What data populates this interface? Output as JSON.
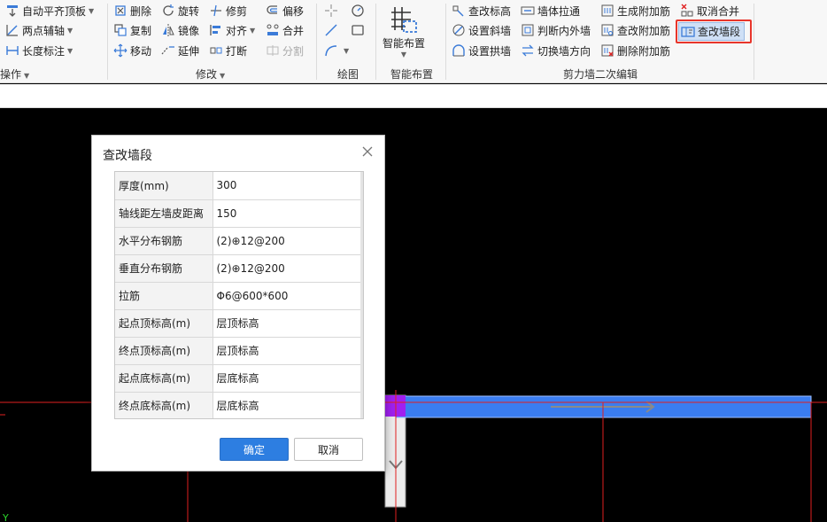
{
  "ribbon": {
    "col1": [
      {
        "label": "自动平齐顶板",
        "icon": "auto-align-top-icon",
        "caret": true
      },
      {
        "label": "两点辅轴",
        "icon": "two-point-axis-icon",
        "caret": true
      },
      {
        "label": "长度标注",
        "icon": "length-dimension-icon",
        "caret": true
      }
    ],
    "group_ops_label": "操作",
    "modify": {
      "delete": "删除",
      "rotate": "旋转",
      "trim": "修剪",
      "offset": "偏移",
      "copy": "复制",
      "mirror": "镜像",
      "align": "对齐",
      "merge": "合并",
      "move": "移动",
      "extend": "延伸",
      "break": "打断",
      "split": "分割",
      "group_label": "修改"
    },
    "draw": {
      "group_label": "绘图"
    },
    "smart": {
      "label": "智能布置",
      "group_label": "智能布置"
    },
    "shearwall": {
      "group_label": "剪力墙二次编辑",
      "check_elev": "查改标高",
      "wall_pull": "墙体拉通",
      "gen_rebar": "生成附加筋",
      "cancel_merge": "取消合并",
      "set_slope": "设置斜墙",
      "judge_inout": "判断内外墙",
      "edit_rebar": "查改附加筋",
      "edit_segment": "查改墙段",
      "set_arch": "设置拱墙",
      "switch_dir": "切换墙方向",
      "del_rebar": "删除附加筋"
    }
  },
  "dialog": {
    "title": "查改墙段",
    "rows": [
      {
        "key": "厚度(mm)",
        "value": "300"
      },
      {
        "key": "轴线距左墙皮距离",
        "value": "150"
      },
      {
        "key": "水平分布钢筋",
        "value": "(2)⊕12@200"
      },
      {
        "key": "垂直分布钢筋",
        "value": "(2)⊕12@200"
      },
      {
        "key": "拉筋",
        "value": "Φ6@600*600"
      },
      {
        "key": "起点顶标高(m)",
        "value": "层顶标高"
      },
      {
        "key": "终点顶标高(m)",
        "value": "层顶标高"
      },
      {
        "key": "起点底标高(m)",
        "value": "层底标高"
      },
      {
        "key": "终点底标高(m)",
        "value": "层底标高"
      }
    ],
    "ok_label": "确定",
    "cancel_label": "取消"
  },
  "canvas": {
    "axis_label": "Y",
    "colors": {
      "wall": "#3a7df0",
      "grid_line": "#e02020",
      "selected": "#a020f0",
      "direction_arrow": "#7a7a7a"
    }
  }
}
